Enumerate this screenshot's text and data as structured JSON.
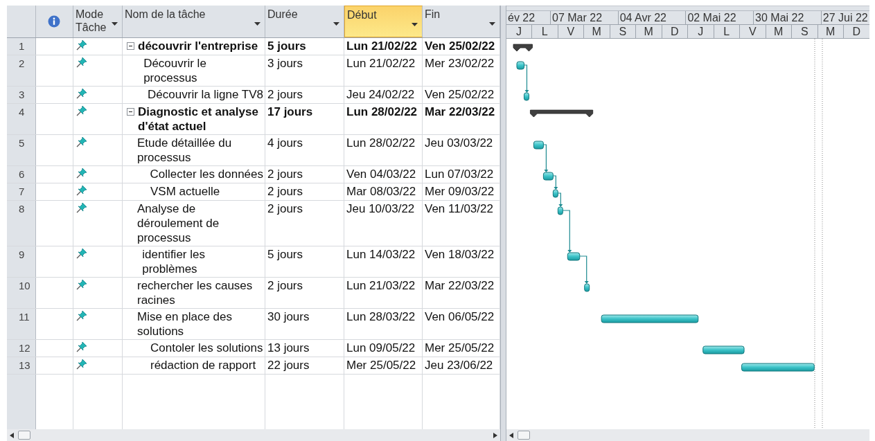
{
  "columns": [
    {
      "label": "Mode Tâche",
      "selected": false
    },
    {
      "label": "Nom de la tâche",
      "selected": false
    },
    {
      "label": "Durée",
      "selected": false
    },
    {
      "label": "Début",
      "selected": true
    },
    {
      "label": "Fin",
      "selected": false
    }
  ],
  "timescale": {
    "top": [
      "év 22",
      "07 Mar 22",
      "04 Avr 22",
      "02 Mai 22",
      "30 Mai 22",
      "27 Jui 22"
    ],
    "bottom": [
      "J",
      "L",
      "V",
      "M",
      "S",
      "M",
      "D",
      "J",
      "L",
      "V",
      "M",
      "S",
      "M",
      "D"
    ]
  },
  "tasks": [
    {
      "id": "1",
      "name": "découvrir l'entreprise",
      "duration": "5 jours",
      "start": "Lun 21/02/22",
      "finish": "Ven 25/02/22",
      "expanded": true,
      "linked": false,
      "children": [
        {
          "id": "2",
          "name": "Découvrir le processus",
          "duration": "3 jours",
          "start": "Lun 21/02/22",
          "finish": "Mer 23/02/22",
          "linked": false
        },
        {
          "id": "3",
          "name": "Découvrir la ligne TV8",
          "duration": "2 jours",
          "start": "Jeu 24/02/22",
          "finish": "Ven 25/02/22",
          "linked": true
        }
      ]
    },
    {
      "id": "4",
      "name": "Diagnostic et analyse d'état actuel",
      "duration": "17 jours",
      "start": "Lun 28/02/22",
      "finish": "Mar 22/03/22",
      "expanded": true,
      "linked": false,
      "children": [
        {
          "id": "5",
          "name": "Etude détaillée du processus",
          "duration": "4 jours",
          "start": "Lun 28/02/22",
          "finish": "Jeu 03/03/22",
          "linked": false
        },
        {
          "id": "6",
          "name": "Collecter les données",
          "duration": "2 jours",
          "start": "Ven 04/03/22",
          "finish": "Lun 07/03/22",
          "linked": true
        },
        {
          "id": "7",
          "name": "VSM actuelle",
          "duration": "2 jours",
          "start": "Mar 08/03/22",
          "finish": "Mer 09/03/22",
          "linked": true
        },
        {
          "id": "8",
          "name": "Analyse de déroulement de processus",
          "duration": "2 jours",
          "start": "Jeu 10/03/22",
          "finish": "Ven 11/03/22",
          "linked": true
        },
        {
          "id": "9",
          "name": "identifier les problèmes",
          "duration": "5 jours",
          "start": "Lun 14/03/22",
          "finish": "Ven 18/03/22",
          "linked": true
        },
        {
          "id": "10",
          "name": "rechercher les causes racines",
          "duration": "2 jours",
          "start": "Lun 21/03/22",
          "finish": "Mar 22/03/22",
          "linked": true
        }
      ]
    },
    {
      "id": "11",
      "name": "Mise en place des solutions",
      "duration": "30 jours",
      "start": "Lun 28/03/22",
      "finish": "Ven 06/05/22",
      "linked": false
    },
    {
      "id": "12",
      "name": "Contoler les solutions",
      "duration": "13 jours",
      "start": "Lun 09/05/22",
      "finish": "Mer 25/05/22",
      "linked": false
    },
    {
      "id": "13",
      "name": "rédaction de rapport",
      "duration": "22 jours",
      "start": "Mer 25/05/22",
      "finish": "Jeu 23/06/22",
      "linked": false
    }
  ]
}
